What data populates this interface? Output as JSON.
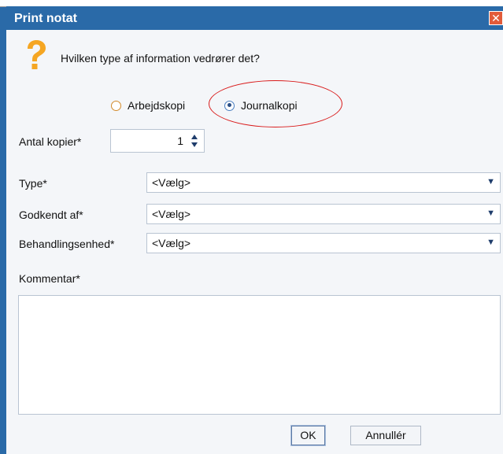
{
  "dialog": {
    "title": "Print notat",
    "close_icon": "close-icon",
    "question_icon": "question-mark-icon",
    "question": "Hvilken type af information vedrører det?"
  },
  "copy_type": {
    "options": [
      {
        "label": "Arbejdskopi",
        "selected": false
      },
      {
        "label": "Journalkopi",
        "selected": true
      }
    ],
    "highlight_color": "#d91b1b"
  },
  "form": {
    "copies_label": "Antal kopier*",
    "copies_value": "1",
    "type_label": "Type*",
    "type_value": "<Vælg>",
    "approved_label": "Godkendt af*",
    "approved_value": "<Vælg>",
    "unit_label": "Behandlingsenhed*",
    "unit_value": "<Vælg>",
    "comment_label": "Kommentar*",
    "comment_value": ""
  },
  "buttons": {
    "ok": "OK",
    "cancel": "Annullér"
  },
  "colors": {
    "titlebar": "#2a6aa8",
    "background": "#f4f6f9",
    "close_button": "#e25b3a",
    "question_icon": "#f5a623"
  }
}
